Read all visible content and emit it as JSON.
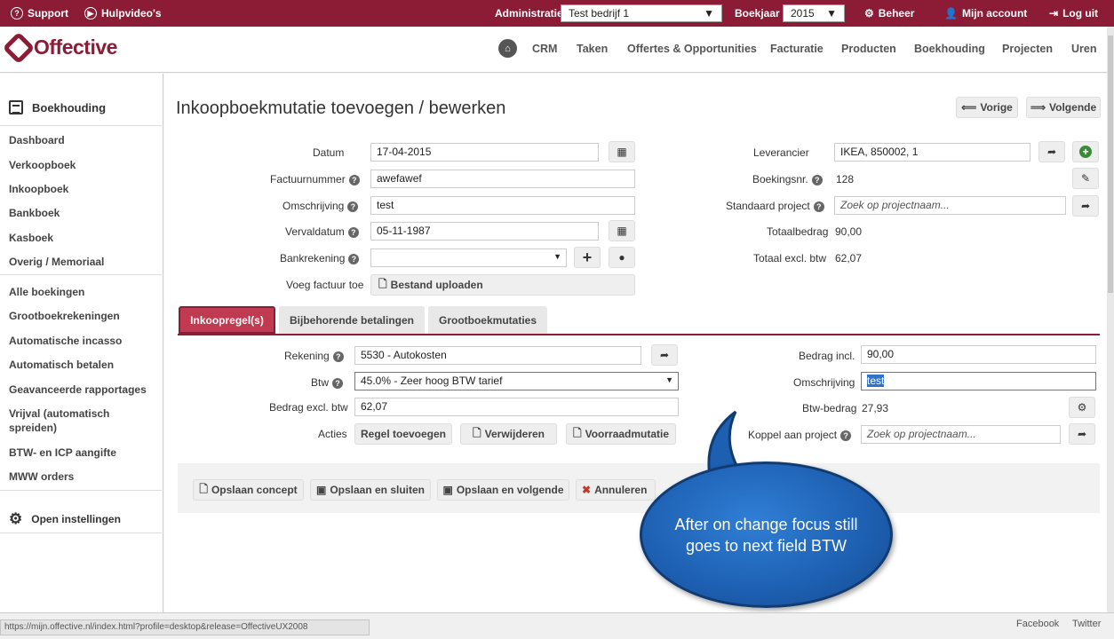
{
  "topbar": {
    "support": "Support",
    "help_videos": "Hulpvideo's",
    "admin_label": "Administratie",
    "admin_value": "Test bedrijf 1",
    "year_label": "Boekjaar",
    "year_value": "2015",
    "manage": "Beheer",
    "account": "Mijn account",
    "logout": "Log uit",
    "bg_color": "#8c1c35"
  },
  "brand": {
    "name": "Offective"
  },
  "nav": {
    "items": [
      "CRM",
      "Taken",
      "Offertes & Opportunities",
      "Facturatie",
      "Producten",
      "Boekhouding",
      "Projecten",
      "Uren"
    ]
  },
  "sidebar": {
    "title": "Boekhouding",
    "items": [
      "Dashboard",
      "Verkoopboek",
      "Inkoopboek",
      "Bankboek",
      "Kasboek",
      "Overig / Memoriaal"
    ],
    "items2": [
      "Alle boekingen",
      "Grootboekrekeningen",
      "Automatische incasso",
      "Automatisch betalen",
      "Geavanceerde rapportages",
      "Vrijval (automatisch spreiden)",
      "BTW- en ICP aangifte",
      "MWW orders"
    ],
    "settings": "Open instellingen"
  },
  "page": {
    "title": "Inkoopboekmutatie toevoegen / bewerken",
    "prev": "Vorige",
    "next": "Volgende"
  },
  "form": {
    "datum_label": "Datum",
    "datum_value": "17-04-2015",
    "factuurnummer_label": "Factuurnummer",
    "factuurnummer_value": "awefawef",
    "omschrijving_label": "Omschrijving",
    "omschrijving_value": "test",
    "vervaldatum_label": "Vervaldatum",
    "vervaldatum_value": "05-11-1987",
    "bankrekening_label": "Bankrekening",
    "bankrekening_value": "",
    "voeg_factuur_label": "Voeg factuur toe",
    "upload_label": "Bestand uploaden",
    "leverancier_label": "Leverancier",
    "leverancier_value": "IKEA, 850002, 1",
    "boekingsnr_label": "Boekingsnr.",
    "boekingsnr_value": "128",
    "std_project_label": "Standaard project",
    "std_project_placeholder": "Zoek op projectnaam...",
    "totaalbedrag_label": "Totaalbedrag",
    "totaalbedrag_value": "90,00",
    "totaal_excl_label": "Totaal excl. btw",
    "totaal_excl_value": "62,07"
  },
  "tabs": [
    "Inkoopregel(s)",
    "Bijbehorende betalingen",
    "Grootboekmutaties"
  ],
  "line": {
    "rekening_label": "Rekening",
    "rekening_value": "5530 - Autokosten",
    "btw_label": "Btw",
    "btw_value": "45.0% - Zeer hoog BTW tarief",
    "bedrag_excl_label": "Bedrag excl. btw",
    "bedrag_excl_value": "62,07",
    "acties_label": "Acties",
    "add_line": "Regel toevoegen",
    "remove": "Verwijderen",
    "stock": "Voorraadmutatie",
    "bedrag_incl_label": "Bedrag incl.",
    "bedrag_incl_value": "90,00",
    "omschrijving_label": "Omschrijving",
    "omschrijving_value": "test",
    "btw_bedrag_label": "Btw-bedrag",
    "btw_bedrag_value": "27,93",
    "koppel_label": "Koppel aan project",
    "koppel_placeholder": "Zoek op projectnaam..."
  },
  "actions": {
    "save_concept": "Opslaan concept",
    "save_close": "Opslaan en sluiten",
    "save_next": "Opslaan en volgende",
    "cancel": "Annuleren"
  },
  "callout": {
    "text": "After on change focus still goes to next field BTW"
  },
  "statusbar": {
    "url": "https://mijn.offective.nl/index.html?profile=desktop&release=OffectiveUX2008",
    "facebook": "Facebook",
    "twitter": "Twitter"
  }
}
